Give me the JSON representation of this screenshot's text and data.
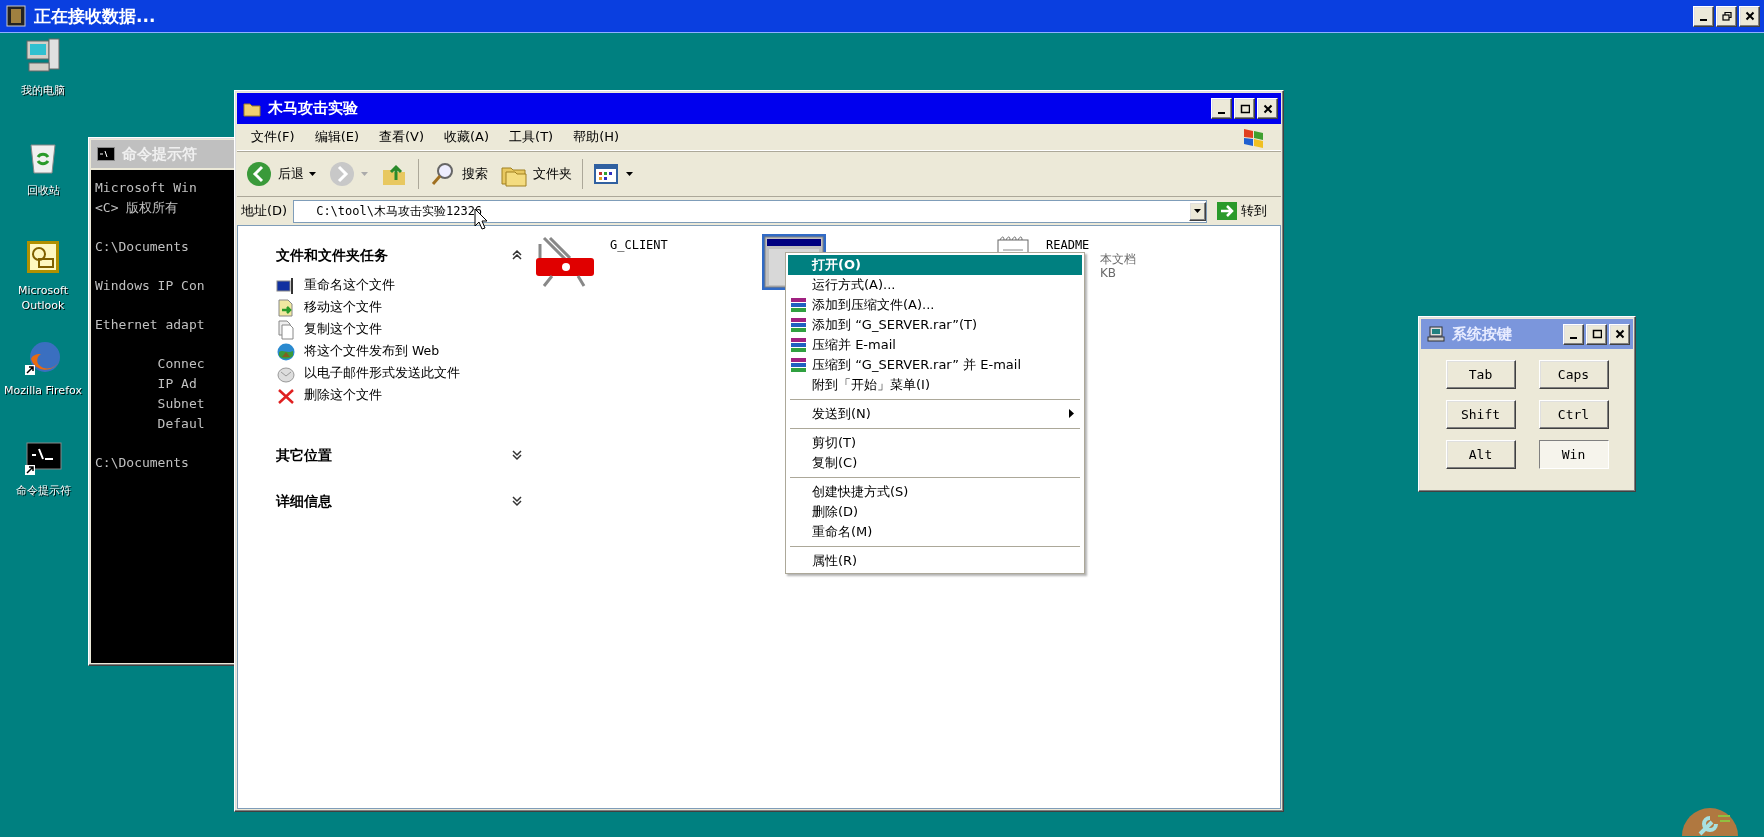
{
  "top_window": {
    "title": "正在接收数据..."
  },
  "desktop_icons": [
    {
      "label": "我的电脑",
      "kind": "computer"
    },
    {
      "label": "回收站",
      "kind": "recycle"
    },
    {
      "label": "Microsoft Outlook",
      "kind": "outlook"
    },
    {
      "label": "Mozilla Firefox",
      "kind": "firefox"
    },
    {
      "label": "命令提示符",
      "kind": "console"
    }
  ],
  "console": {
    "title": "命令提示符",
    "active": false,
    "blocks": [
      [
        "Microsoft Win",
        "<C> 版权所有"
      ],
      [
        "C:\\Documents"
      ],
      [
        "Windows IP Con"
      ],
      [
        "Ethernet adapt"
      ],
      [
        "        Connec",
        "        IP Ad",
        "        Subnet",
        "        Defaul"
      ],
      [
        "C:\\Documents"
      ]
    ]
  },
  "explorer": {
    "title": "木马攻击实验",
    "active": true,
    "menu": [
      "文件(F)",
      "编辑(E)",
      "查看(V)",
      "收藏(A)",
      "工具(T)",
      "帮助(H)"
    ],
    "toolbar": [
      {
        "kind": "back",
        "label": "后退",
        "disabled": false
      },
      {
        "kind": "forward",
        "disabled": true
      },
      {
        "kind": "up",
        "disabled": false
      },
      {
        "kind": "search",
        "label": "搜索",
        "disabled": false
      },
      {
        "kind": "folders",
        "label": "文件夹",
        "disabled": false
      },
      {
        "kind": "views",
        "disabled": false
      }
    ],
    "address": {
      "label": "地址(D)",
      "value": "C:\\tool\\木马攻击实验12326",
      "go": "转到"
    },
    "task_groups": [
      {
        "title": "文件和文件夹任务",
        "expanded": true,
        "items": [
          {
            "label": "重命名这个文件",
            "kind": "rename"
          },
          {
            "label": "移动这个文件",
            "kind": "move"
          },
          {
            "label": "复制这个文件",
            "kind": "copy"
          },
          {
            "label": "将这个文件发布到 Web",
            "kind": "publish"
          },
          {
            "label": "以电子邮件形式发送此文件",
            "kind": "email"
          },
          {
            "label": "删除这个文件",
            "kind": "delete"
          }
        ]
      },
      {
        "title": "其它位置",
        "expanded": false
      },
      {
        "title": "详细信息",
        "expanded": false
      }
    ],
    "files": [
      {
        "name": "G_CLIENT",
        "kind": "app",
        "selected": false
      },
      {
        "kind": "window",
        "selected": true
      },
      {
        "name": "README",
        "kind": "text",
        "selected": false,
        "details": [
          "本文档",
          "KB"
        ]
      }
    ]
  },
  "context_menu": [
    {
      "kind": "item",
      "label": "打开(O)",
      "selected": true,
      "default": true
    },
    {
      "kind": "item",
      "label": "运行方式(A)...",
      "selected": false
    },
    {
      "kind": "archive",
      "label": "添加到压缩文件(A)...",
      "selected": false
    },
    {
      "kind": "archive",
      "label": "添加到 “G_SERVER.rar”(T)",
      "selected": false
    },
    {
      "kind": "archive",
      "label": "压缩并 E-mail",
      "selected": false
    },
    {
      "kind": "archive",
      "label": "压缩到 “G_SERVER.rar” 并 E-mail",
      "selected": false
    },
    {
      "kind": "item",
      "label": "附到「开始」菜单(I)",
      "selected": false
    },
    {
      "kind": "separator"
    },
    {
      "kind": "item",
      "label": "发送到(N)",
      "selected": false,
      "submenu": true
    },
    {
      "kind": "separator"
    },
    {
      "kind": "item",
      "label": "剪切(T)",
      "selected": false
    },
    {
      "kind": "item",
      "label": "复制(C)",
      "selected": false
    },
    {
      "kind": "separator"
    },
    {
      "kind": "item",
      "label": "创建快捷方式(S)",
      "selected": false
    },
    {
      "kind": "item",
      "label": "删除(D)",
      "selected": false
    },
    {
      "kind": "item",
      "label": "重命名(M)",
      "selected": false
    },
    {
      "kind": "separator"
    },
    {
      "kind": "item",
      "label": "属性(R)",
      "selected": false
    }
  ],
  "system_keys": {
    "title": "系统按键",
    "active": false,
    "keys": [
      {
        "label": "Tab",
        "pressed": false
      },
      {
        "label": "Caps",
        "pressed": false
      },
      {
        "label": "Shift",
        "pressed": false
      },
      {
        "label": "Ctrl",
        "pressed": false
      },
      {
        "label": "Alt",
        "pressed": false
      },
      {
        "label": "Win",
        "pressed": true
      }
    ]
  }
}
